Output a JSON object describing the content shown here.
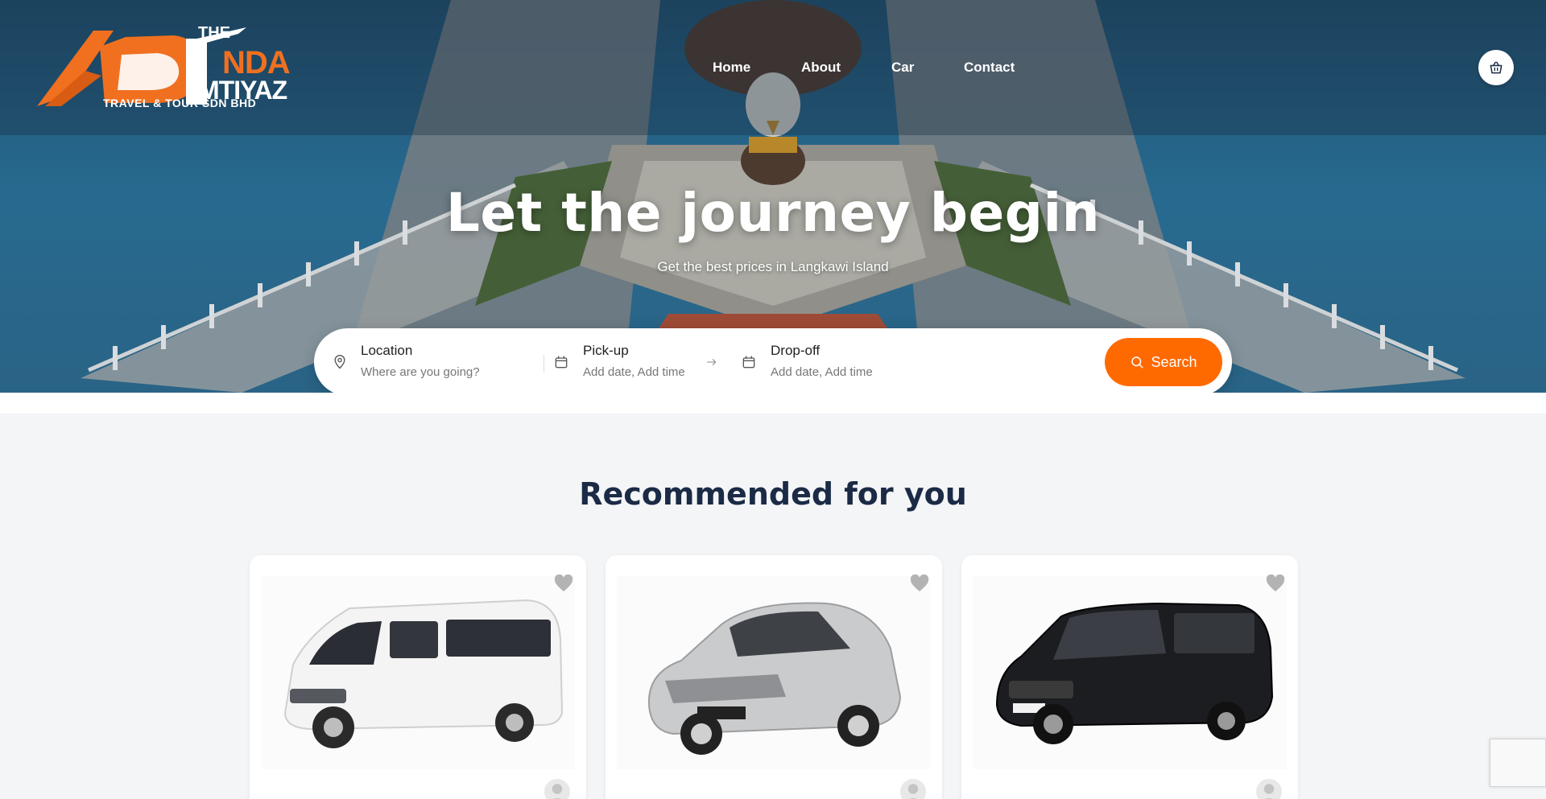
{
  "brand": {
    "logo_the": "THE",
    "logo_nda": "NDA",
    "logo_mtiyaz": "MTIYAZ",
    "logo_sub": "TRAVEL & TOUR SDN BHD",
    "accent": "#f07020"
  },
  "nav": {
    "items": [
      {
        "label": "Home"
      },
      {
        "label": "About"
      },
      {
        "label": "Car"
      },
      {
        "label": "Contact"
      }
    ]
  },
  "header": {
    "cart_icon": "basket-icon"
  },
  "hero": {
    "title": "Let the journey begin",
    "subtitle": "Get the best prices in Langkawi Island"
  },
  "search": {
    "location_label": "Location",
    "location_placeholder": "Where are you going?",
    "pickup_label": "Pick-up",
    "pickup_value": "Add date, Add time",
    "dropoff_label": "Drop-off",
    "dropoff_value": "Add date, Add time",
    "button_label": "Search",
    "button_color": "#ff6a00"
  },
  "recommended": {
    "title": "Recommended for you",
    "cards": [
      {
        "vehicle": "white-van",
        "icon": "heart-icon"
      },
      {
        "vehicle": "silver-sedan",
        "icon": "heart-icon"
      },
      {
        "vehicle": "black-mpv",
        "icon": "heart-icon"
      }
    ]
  }
}
